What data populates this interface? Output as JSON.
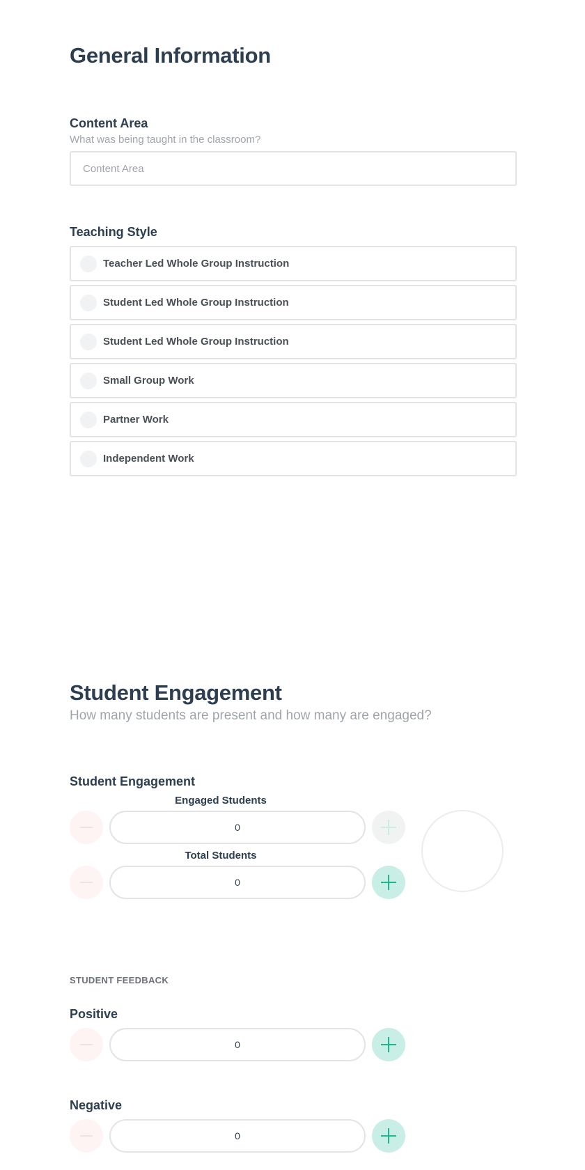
{
  "general": {
    "title": "General Information",
    "content_area": {
      "label": "Content Area",
      "help": "What was being taught in the classroom?",
      "placeholder": "Content Area",
      "value": ""
    },
    "teaching_style": {
      "label": "Teaching Style",
      "options": [
        {
          "label": "Teacher Led Whole Group Instruction",
          "selected": false
        },
        {
          "label": "Student Led Whole Group Instruction",
          "selected": false
        },
        {
          "label": "Student Led Whole Group Instruction",
          "selected": false
        },
        {
          "label": "Small Group Work",
          "selected": false
        },
        {
          "label": "Partner Work",
          "selected": false
        },
        {
          "label": "Independent Work",
          "selected": false
        }
      ]
    }
  },
  "engagement": {
    "title": "Student Engagement",
    "subtitle": "How many students are present and how many are engaged?",
    "field_label": "Student Engagement",
    "engaged": {
      "label": "Engaged Students",
      "value": "0"
    },
    "total": {
      "label": "Total Students",
      "value": "0"
    }
  },
  "feedback": {
    "overline": "STUDENT FEEDBACK",
    "positive": {
      "label": "Positive",
      "value": "0"
    },
    "negative": {
      "label": "Negative",
      "value": "0"
    }
  },
  "colors": {
    "heading": "#2c3e50",
    "muted": "#a0a4ab",
    "accent": "#1fb58f",
    "accent_bg": "#c8eee5",
    "minus_bg": "#fdf4f3",
    "border": "#e4e4e4"
  }
}
